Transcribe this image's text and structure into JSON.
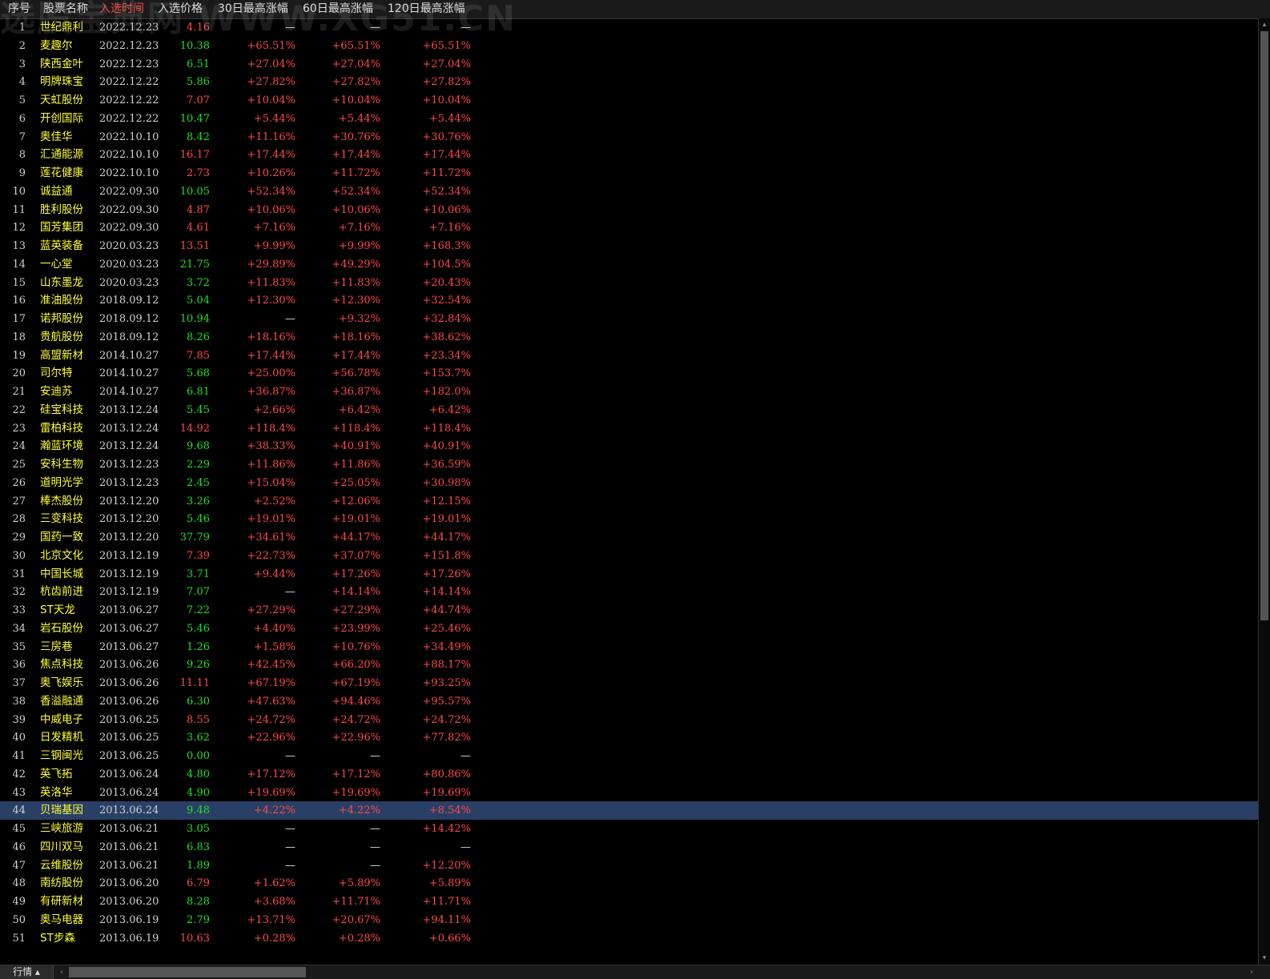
{
  "watermark": "选股宝典网 WWW.XG51.CN",
  "columns": {
    "idx": "序号",
    "name": "股票名称",
    "date": "入选时间",
    "price": "入选价格",
    "r30": "30日最高涨幅",
    "r60": "60日最高涨幅",
    "r120": "120日最高涨幅"
  },
  "active_column": "date",
  "selected_row": 44,
  "colors": {
    "up": "#ff4a4a",
    "down": "#20e020",
    "name": "#ffff33",
    "selected_row_bg": "#2a3f66"
  },
  "rows": [
    {
      "idx": "1",
      "name": "世纪鼎利",
      "date": "2022.12.23",
      "price": "4.16",
      "pc": "up",
      "r30": "—",
      "r60": "—",
      "r120": "—"
    },
    {
      "idx": "2",
      "name": "麦趣尔",
      "date": "2022.12.23",
      "price": "10.38",
      "pc": "down",
      "r30": "+65.51%",
      "r60": "+65.51%",
      "r120": "+65.51%"
    },
    {
      "idx": "3",
      "name": "陕西金叶",
      "date": "2022.12.23",
      "price": "6.51",
      "pc": "down",
      "r30": "+27.04%",
      "r60": "+27.04%",
      "r120": "+27.04%"
    },
    {
      "idx": "4",
      "name": "明牌珠宝",
      "date": "2022.12.22",
      "price": "5.86",
      "pc": "down",
      "r30": "+27.82%",
      "r60": "+27.82%",
      "r120": "+27.82%"
    },
    {
      "idx": "5",
      "name": "天虹股份",
      "date": "2022.12.22",
      "price": "7.07",
      "pc": "up",
      "r30": "+10.04%",
      "r60": "+10.04%",
      "r120": "+10.04%"
    },
    {
      "idx": "6",
      "name": "开创国际",
      "date": "2022.12.22",
      "price": "10.47",
      "pc": "down",
      "r30": "+5.44%",
      "r60": "+5.44%",
      "r120": "+5.44%"
    },
    {
      "idx": "7",
      "name": "奥佳华",
      "date": "2022.10.10",
      "price": "8.42",
      "pc": "down",
      "r30": "+11.16%",
      "r60": "+30.76%",
      "r120": "+30.76%"
    },
    {
      "idx": "8",
      "name": "汇通能源",
      "date": "2022.10.10",
      "price": "16.17",
      "pc": "up",
      "r30": "+17.44%",
      "r60": "+17.44%",
      "r120": "+17.44%"
    },
    {
      "idx": "9",
      "name": "莲花健康",
      "date": "2022.10.10",
      "price": "2.73",
      "pc": "up",
      "r30": "+10.26%",
      "r60": "+11.72%",
      "r120": "+11.72%"
    },
    {
      "idx": "10",
      "name": "诚益通",
      "date": "2022.09.30",
      "price": "10.05",
      "pc": "down",
      "r30": "+52.34%",
      "r60": "+52.34%",
      "r120": "+52.34%"
    },
    {
      "idx": "11",
      "name": "胜利股份",
      "date": "2022.09.30",
      "price": "4.87",
      "pc": "up",
      "r30": "+10.06%",
      "r60": "+10.06%",
      "r120": "+10.06%"
    },
    {
      "idx": "12",
      "name": "国芳集团",
      "date": "2022.09.30",
      "price": "4.61",
      "pc": "up",
      "r30": "+7.16%",
      "r60": "+7.16%",
      "r120": "+7.16%"
    },
    {
      "idx": "13",
      "name": "蓝英装备",
      "date": "2020.03.23",
      "price": "13.51",
      "pc": "up",
      "r30": "+9.99%",
      "r60": "+9.99%",
      "r120": "+168.3%"
    },
    {
      "idx": "14",
      "name": "一心堂",
      "date": "2020.03.23",
      "price": "21.75",
      "pc": "down",
      "r30": "+29.89%",
      "r60": "+49.29%",
      "r120": "+104.5%"
    },
    {
      "idx": "15",
      "name": "山东墨龙",
      "date": "2020.03.23",
      "price": "3.72",
      "pc": "down",
      "r30": "+11.83%",
      "r60": "+11.83%",
      "r120": "+20.43%"
    },
    {
      "idx": "16",
      "name": "准油股份",
      "date": "2018.09.12",
      "price": "5.04",
      "pc": "down",
      "r30": "+12.30%",
      "r60": "+12.30%",
      "r120": "+32.54%"
    },
    {
      "idx": "17",
      "name": "诺邦股份",
      "date": "2018.09.12",
      "price": "10.94",
      "pc": "down",
      "r30": "—",
      "r60": "+9.32%",
      "r120": "+32.84%"
    },
    {
      "idx": "18",
      "name": "贵航股份",
      "date": "2018.09.12",
      "price": "8.26",
      "pc": "down",
      "r30": "+18.16%",
      "r60": "+18.16%",
      "r120": "+38.62%"
    },
    {
      "idx": "19",
      "name": "高盟新材",
      "date": "2014.10.27",
      "price": "7.85",
      "pc": "up",
      "r30": "+17.44%",
      "r60": "+17.44%",
      "r120": "+23.34%"
    },
    {
      "idx": "20",
      "name": "司尔特",
      "date": "2014.10.27",
      "price": "5.68",
      "pc": "down",
      "r30": "+25.00%",
      "r60": "+56.78%",
      "r120": "+153.7%"
    },
    {
      "idx": "21",
      "name": "安迪苏",
      "date": "2014.10.27",
      "price": "6.81",
      "pc": "down",
      "r30": "+36.87%",
      "r60": "+36.87%",
      "r120": "+182.0%"
    },
    {
      "idx": "22",
      "name": "硅宝科技",
      "date": "2013.12.24",
      "price": "5.45",
      "pc": "down",
      "r30": "+2.66%",
      "r60": "+6.42%",
      "r120": "+6.42%"
    },
    {
      "idx": "23",
      "name": "雷柏科技",
      "date": "2013.12.24",
      "price": "14.92",
      "pc": "up",
      "r30": "+118.4%",
      "r60": "+118.4%",
      "r120": "+118.4%"
    },
    {
      "idx": "24",
      "name": "瀚蓝环境",
      "date": "2013.12.24",
      "price": "9.68",
      "pc": "down",
      "r30": "+38.33%",
      "r60": "+40.91%",
      "r120": "+40.91%"
    },
    {
      "idx": "25",
      "name": "安科生物",
      "date": "2013.12.23",
      "price": "2.29",
      "pc": "down",
      "r30": "+11.86%",
      "r60": "+11.86%",
      "r120": "+36.59%"
    },
    {
      "idx": "26",
      "name": "道明光学",
      "date": "2013.12.23",
      "price": "2.45",
      "pc": "down",
      "r30": "+15.04%",
      "r60": "+25.05%",
      "r120": "+30.98%"
    },
    {
      "idx": "27",
      "name": "棒杰股份",
      "date": "2013.12.20",
      "price": "3.26",
      "pc": "down",
      "r30": "+2.52%",
      "r60": "+12.06%",
      "r120": "+12.15%"
    },
    {
      "idx": "28",
      "name": "三变科技",
      "date": "2013.12.20",
      "price": "5.46",
      "pc": "down",
      "r30": "+19.01%",
      "r60": "+19.01%",
      "r120": "+19.01%"
    },
    {
      "idx": "29",
      "name": "国药一致",
      "date": "2013.12.20",
      "price": "37.79",
      "pc": "down",
      "r30": "+34.61%",
      "r60": "+44.17%",
      "r120": "+44.17%"
    },
    {
      "idx": "30",
      "name": "北京文化",
      "date": "2013.12.19",
      "price": "7.39",
      "pc": "up",
      "r30": "+22.73%",
      "r60": "+37.07%",
      "r120": "+151.8%"
    },
    {
      "idx": "31",
      "name": "中国长城",
      "date": "2013.12.19",
      "price": "3.71",
      "pc": "down",
      "r30": "+9.44%",
      "r60": "+17.26%",
      "r120": "+17.26%"
    },
    {
      "idx": "32",
      "name": "杭齿前进",
      "date": "2013.12.19",
      "price": "7.07",
      "pc": "down",
      "r30": "—",
      "r60": "+14.14%",
      "r120": "+14.14%"
    },
    {
      "idx": "33",
      "name": "ST天龙",
      "date": "2013.06.27",
      "price": "7.22",
      "pc": "down",
      "r30": "+27.29%",
      "r60": "+27.29%",
      "r120": "+44.74%"
    },
    {
      "idx": "34",
      "name": "岩石股份",
      "date": "2013.06.27",
      "price": "5.46",
      "pc": "down",
      "r30": "+4.40%",
      "r60": "+23.99%",
      "r120": "+25.46%"
    },
    {
      "idx": "35",
      "name": "三房巷",
      "date": "2013.06.27",
      "price": "1.26",
      "pc": "down",
      "r30": "+1.58%",
      "r60": "+10.76%",
      "r120": "+34.49%"
    },
    {
      "idx": "36",
      "name": "焦点科技",
      "date": "2013.06.26",
      "price": "9.26",
      "pc": "down",
      "r30": "+42.45%",
      "r60": "+66.20%",
      "r120": "+88.17%"
    },
    {
      "idx": "37",
      "name": "奥飞娱乐",
      "date": "2013.06.26",
      "price": "11.11",
      "pc": "up",
      "r30": "+67.19%",
      "r60": "+67.19%",
      "r120": "+93.25%"
    },
    {
      "idx": "38",
      "name": "香溢融通",
      "date": "2013.06.26",
      "price": "6.30",
      "pc": "down",
      "r30": "+47.63%",
      "r60": "+94.46%",
      "r120": "+95.57%"
    },
    {
      "idx": "39",
      "name": "中威电子",
      "date": "2013.06.25",
      "price": "8.55",
      "pc": "up",
      "r30": "+24.72%",
      "r60": "+24.72%",
      "r120": "+24.72%"
    },
    {
      "idx": "40",
      "name": "日发精机",
      "date": "2013.06.25",
      "price": "3.62",
      "pc": "down",
      "r30": "+22.96%",
      "r60": "+22.96%",
      "r120": "+77.82%"
    },
    {
      "idx": "41",
      "name": "三钢闽光",
      "date": "2013.06.25",
      "price": "0.00",
      "pc": "down",
      "r30": "—",
      "r60": "—",
      "r120": "—"
    },
    {
      "idx": "42",
      "name": "英飞拓",
      "date": "2013.06.24",
      "price": "4.80",
      "pc": "down",
      "r30": "+17.12%",
      "r60": "+17.12%",
      "r120": "+80.86%"
    },
    {
      "idx": "43",
      "name": "英洛华",
      "date": "2013.06.24",
      "price": "4.90",
      "pc": "down",
      "r30": "+19.69%",
      "r60": "+19.69%",
      "r120": "+19.69%"
    },
    {
      "idx": "44",
      "name": "贝瑞基因",
      "date": "2013.06.24",
      "price": "9.48",
      "pc": "down",
      "r30": "+4.22%",
      "r60": "+4.22%",
      "r120": "+8.54%"
    },
    {
      "idx": "45",
      "name": "三峡旅游",
      "date": "2013.06.21",
      "price": "3.05",
      "pc": "down",
      "r30": "—",
      "r60": "—",
      "r120": "+14.42%"
    },
    {
      "idx": "46",
      "name": "四川双马",
      "date": "2013.06.21",
      "price": "6.83",
      "pc": "down",
      "r30": "—",
      "r60": "—",
      "r120": "—"
    },
    {
      "idx": "47",
      "name": "云维股份",
      "date": "2013.06.21",
      "price": "1.89",
      "pc": "down",
      "r30": "—",
      "r60": "—",
      "r120": "+12.20%"
    },
    {
      "idx": "48",
      "name": "南纺股份",
      "date": "2013.06.20",
      "price": "6.79",
      "pc": "up",
      "r30": "+1.62%",
      "r60": "+5.89%",
      "r120": "+5.89%"
    },
    {
      "idx": "49",
      "name": "有研新材",
      "date": "2013.06.20",
      "price": "8.28",
      "pc": "down",
      "r30": "+3.68%",
      "r60": "+11.71%",
      "r120": "+11.71%"
    },
    {
      "idx": "50",
      "name": "奥马电器",
      "date": "2013.06.19",
      "price": "2.79",
      "pc": "down",
      "r30": "+13.71%",
      "r60": "+20.67%",
      "r120": "+94.11%"
    },
    {
      "idx": "51",
      "name": "ST步森",
      "date": "2013.06.19",
      "price": "10.63",
      "pc": "up",
      "r30": "+0.28%",
      "r60": "+0.28%",
      "r120": "+0.66%"
    }
  ],
  "bottom": {
    "tab_label": "行情 ▴",
    "scroll_left": "‹",
    "scroll_right": "›",
    "scroll_up": "▴",
    "scroll_down": "▾"
  }
}
